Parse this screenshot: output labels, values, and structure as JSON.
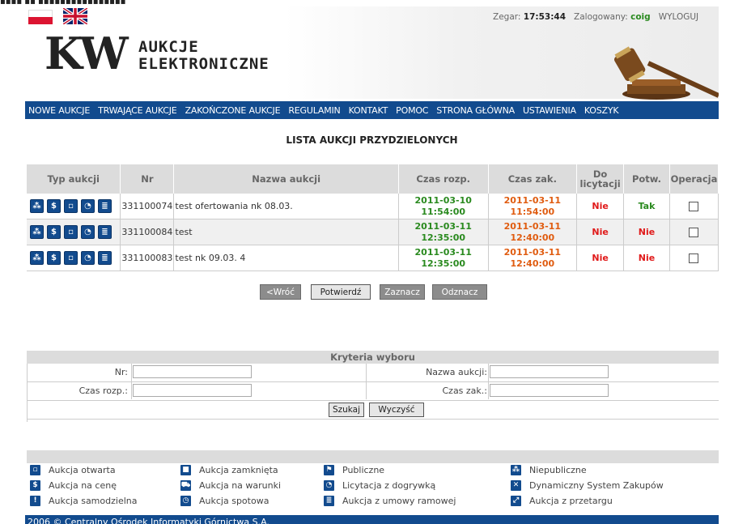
{
  "header": {
    "clock_label": "Zegar:",
    "clock_value": "17:53:44",
    "logged_label": "Zalogowany:",
    "user": "coig",
    "logout": "WYLOGUJ",
    "logo_mark": "KW",
    "logo_line1": "AUKCJE",
    "logo_line2": "ELEKTRONICZNE"
  },
  "menu": [
    "NOWE AUKCJE",
    "TRWAJĄCE AUKCJE",
    "ZAKOŃCZONE AUKCJE",
    "REGULAMIN",
    "KONTAKT",
    "POMOC",
    "STRONA GŁÓWNA",
    "USTAWIENIA",
    "KOSZYK"
  ],
  "page_title": "LISTA AUKCJI PRZYDZIELONYCH",
  "table": {
    "headers": [
      "Typ aukcji",
      "Nr",
      "Nazwa aukcji",
      "Czas rozp.",
      "Czas zak.",
      "Do licytacji",
      "Potw.",
      "Operacja"
    ],
    "rows": [
      {
        "nr": "331100074",
        "name": "test ofertowania nk 08.03.",
        "start_date": "2011-03-10",
        "start_time": "11:54:00",
        "end_date": "2011-03-11",
        "end_time": "11:54:00",
        "do_licytacji": "Nie",
        "potw": "Tak"
      },
      {
        "nr": "331100084",
        "name": "test",
        "start_date": "2011-03-11",
        "start_time": "12:35:00",
        "end_date": "2011-03-11",
        "end_time": "12:40:00",
        "do_licytacji": "Nie",
        "potw": "Nie"
      },
      {
        "nr": "331100083",
        "name": "test nk 09.03. 4",
        "start_date": "2011-03-11",
        "start_time": "12:35:00",
        "end_date": "2011-03-11",
        "end_time": "12:40:00",
        "do_licytacji": "Nie",
        "potw": "Nie"
      }
    ]
  },
  "buttons": {
    "back": "<Wróć",
    "confirm": "Potwierdź",
    "select": "Zaznacz",
    "deselect": "Odznacz"
  },
  "criteria": {
    "title": "Kryteria wyboru",
    "nr_label": "Nr:",
    "name_label": "Nazwa aukcji:",
    "start_label": "Czas rozp.:",
    "end_label": "Czas zak.:",
    "search": "Szukaj",
    "clear": "Wyczyść"
  },
  "legend": [
    [
      "Aukcja otwarta",
      "Aukcja zamknięta",
      "Publiczne",
      "Niepubliczne"
    ],
    [
      "Aukcja na cenę",
      "Aukcja na warunki",
      "Licytacja z dogrywką",
      "Dynamiczny System Zakupów"
    ],
    [
      "Aukcja samodzielna",
      "Aukcja spotowa",
      "Aukcja z umowy ramowej",
      "Aukcja z przetargu"
    ]
  ],
  "footer": "2006 © Centralny Ośrodek Informatyki Górnictwa S.A.",
  "colors": {
    "nav": "#124b8e",
    "green": "#2a8a1f",
    "orange": "#e05c10",
    "red": "#e01a1a"
  },
  "icons": [
    "puzzle-icon",
    "dollar-icon",
    "lock-open-icon",
    "clock-icon",
    "document-icon"
  ]
}
